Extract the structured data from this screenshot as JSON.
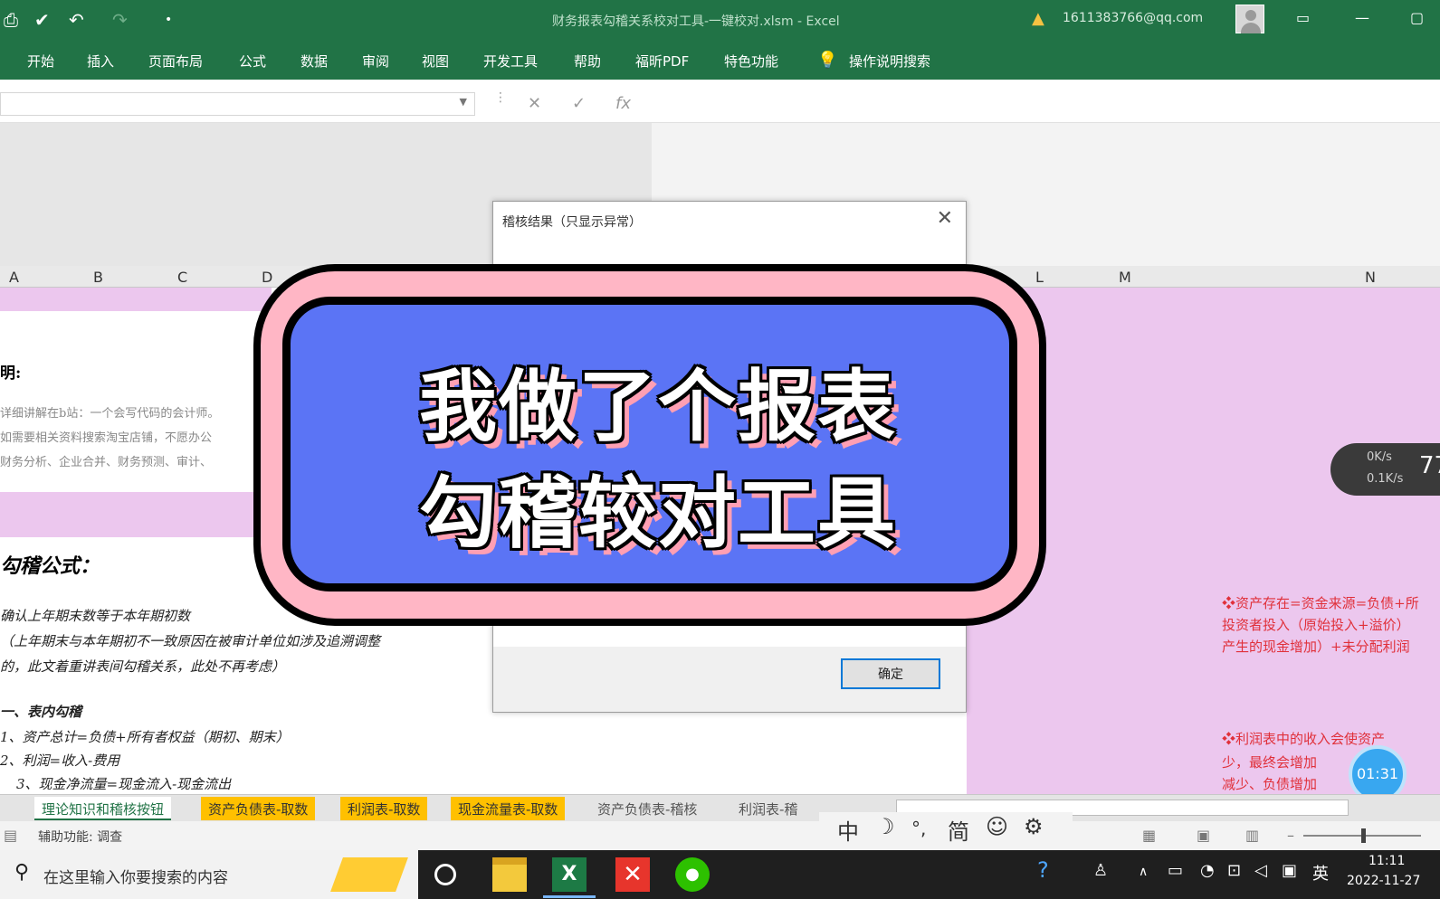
{
  "titlebar": {
    "title": "财务报表勾稽关系校对工具-一键校对.xlsm  -  Excel",
    "account": "1611383766@qq.com",
    "warning_icon": "warning-icon",
    "minimize": "—",
    "restore": "▢",
    "ribbon_toggle": "▭"
  },
  "ribbon": {
    "tabs": [
      "开始",
      "插入",
      "页面布局",
      "公式",
      "数据",
      "审阅",
      "视图",
      "开发工具",
      "帮助",
      "福昕PDF",
      "特色功能"
    ],
    "tell_me": "操作说明搜索"
  },
  "formula_bar": {
    "cancel": "✕",
    "enter": "✓",
    "fx": "fx"
  },
  "columns": [
    "A",
    "B",
    "C",
    "D",
    "L",
    "M",
    "N"
  ],
  "sheet": {
    "left_heading": "明:",
    "left_lines": [
      "详细讲解在b站：一个会写代码的会计师。",
      "如需要相关资料搜索淘宝店铺，不愿办公",
      "财务分析、企业合并、财务预测、审计、"
    ],
    "formula_heading": "勾稽公式：",
    "hand_lines": [
      "确认上年期末数等于本年期初数",
      "（上年期末与本年期初不一致原因在被审计单位如涉及追溯调整",
      "的，此文着重讲表间勾稽关系，此处不再考虑）",
      "一、表内勾稽",
      "1、资产总计=负债+所有者权益（期初、期末）",
      "2、利润=收入-费用",
      "3、现金净流量=现金流入-现金流出"
    ],
    "red_lines_a": [
      "❖资产存在=资金来源=负债+所",
      "投资者投入（原始投入+溢价）",
      "产生的现金增加）+未分配利润"
    ],
    "red_lines_b": [
      "❖利润表中的收入会使资产",
      "少，最终会增加",
      "减少、负债增加"
    ]
  },
  "dialog": {
    "title": "稽核结果（只显示异常）",
    "close": "✕",
    "ok": "确定"
  },
  "banner": {
    "line1": "我做了个报表",
    "line2": "勾稽较对工具"
  },
  "net_widget": {
    "down": "0K/s",
    "up": "0.1K/s",
    "value": "77"
  },
  "timer": "01:31",
  "sheet_tabs": [
    {
      "label": "理论知识和稽核按钮",
      "style": "active"
    },
    {
      "label": "资产负债表-取数",
      "style": "gold"
    },
    {
      "label": "利润表-取数",
      "style": "gold"
    },
    {
      "label": "现金流量表-取数",
      "style": "gold"
    },
    {
      "label": "资产负债表-稽核",
      "style": "plain"
    },
    {
      "label": "利润表-稽",
      "style": "plain"
    }
  ],
  "ime": [
    "中",
    "☽",
    "°,",
    "简",
    "☺",
    "⚙"
  ],
  "status": {
    "accessibility": "辅助功能: 调查"
  },
  "taskbar": {
    "search_placeholder": "在这里输入你要搜索的内容",
    "excel_letter": "X",
    "ime_lang": "英",
    "time": "11:11",
    "date": "2022-11-27"
  }
}
